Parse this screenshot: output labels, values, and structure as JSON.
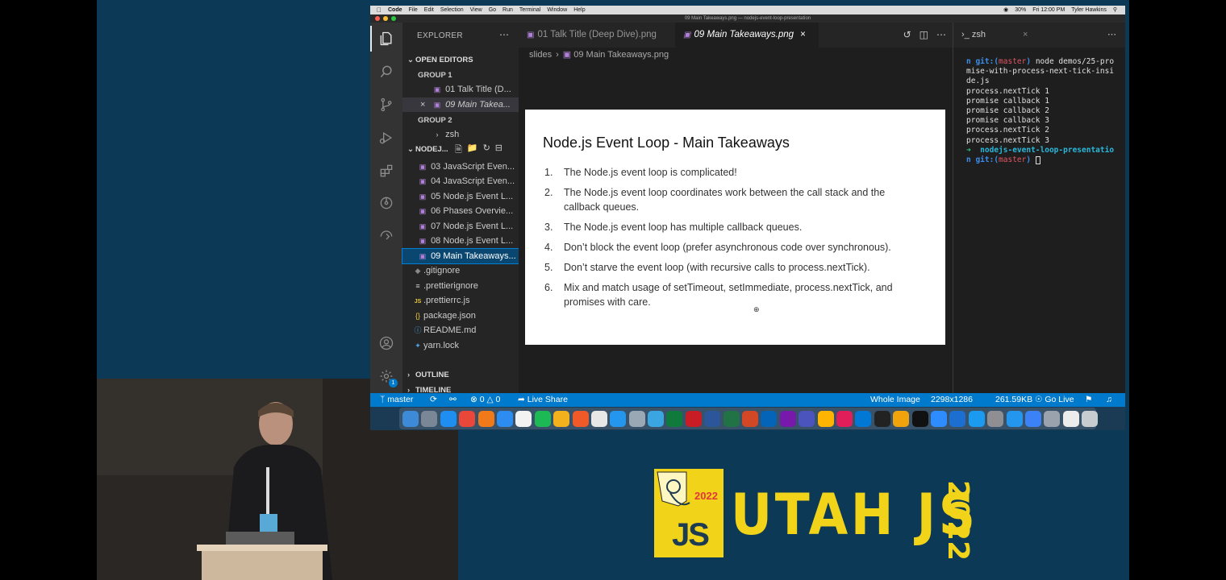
{
  "menubar": {
    "app": "Code",
    "items": [
      "File",
      "Edit",
      "Selection",
      "View",
      "Go",
      "Run",
      "Terminal",
      "Window",
      "Help"
    ],
    "battery": "30%",
    "clock": "Fri 12:00 PM",
    "user": "Tyler Hawkins"
  },
  "window_title": "09 Main Takeaways.png — nodejs-event-loop-presentation",
  "sidebar": {
    "title": "EXPLORER",
    "open_editors": "OPEN EDITORS",
    "group1": "GROUP 1",
    "group1_items": [
      "01 Talk Title (D...",
      "09 Main Takea..."
    ],
    "group2": "GROUP 2",
    "group2_items": [
      "zsh"
    ],
    "project": "NODEJ...",
    "files": [
      "03 JavaScript Even...",
      "04 JavaScript Even...",
      "05 Node.js Event L...",
      "06 Phases Overvie...",
      "07 Node.js Event L...",
      "08 Node.js Event L...",
      "09 Main Takeaways...",
      ".gitignore",
      ".prettierignore",
      ".prettierrc.js",
      "package.json",
      "README.md",
      "yarn.lock"
    ],
    "outline": "OUTLINE",
    "timeline": "TIMELINE"
  },
  "editor": {
    "tabs": [
      "01 Talk Title (Deep Dive).png",
      "09 Main Takeaways.png"
    ],
    "breadcrumb": [
      "slides",
      "09 Main Takeaways.png"
    ]
  },
  "slide": {
    "title": "Node.js Event Loop - Main Takeaways",
    "items": [
      "The Node.js event loop is complicated!",
      "The Node.js event loop coordinates work between the call stack and the callback queues.",
      "The Node.js event loop has multiple callback queues.",
      "Don’t block the event loop (prefer asynchronous code over synchronous).",
      "Don’t starve the event loop (with recursive calls to process.nextTick).",
      "Mix and match usage of setTimeout, setImmediate, process.nextTick, and promises with care."
    ]
  },
  "terminal": {
    "tab": "zsh",
    "prompt_user": "n git:(",
    "prompt_branch": "master",
    "prompt_close": ")",
    "command": " node demos/25-pro\nmise-with-process-next-tick-insi\nde.js",
    "output": [
      "process.nextTick 1",
      "promise callback 1",
      "promise callback 2",
      "promise callback 3",
      "process.nextTick 2",
      "process.nextTick 3"
    ],
    "prompt_arrow": "➜",
    "prompt_dir": "  nodejs-event-loop-presentatio",
    "prompt2_prefix": "n git:("
  },
  "statusbar": {
    "branch": "master",
    "errors": "0",
    "warnings": "0",
    "live_share": "Live Share",
    "zoom": "Whole Image",
    "dimensions": "2298x1286",
    "filesize": "261.59KB",
    "go_live": "Go Live"
  },
  "activity_badge": "1",
  "banner": {
    "logo_year": "2022",
    "logo_js": "JS",
    "title": "UTAH JS",
    "year": "2022"
  },
  "colors": {
    "accent": "#007acc",
    "banner_yellow": "#f1d419",
    "backdrop": "#0c3a56"
  }
}
